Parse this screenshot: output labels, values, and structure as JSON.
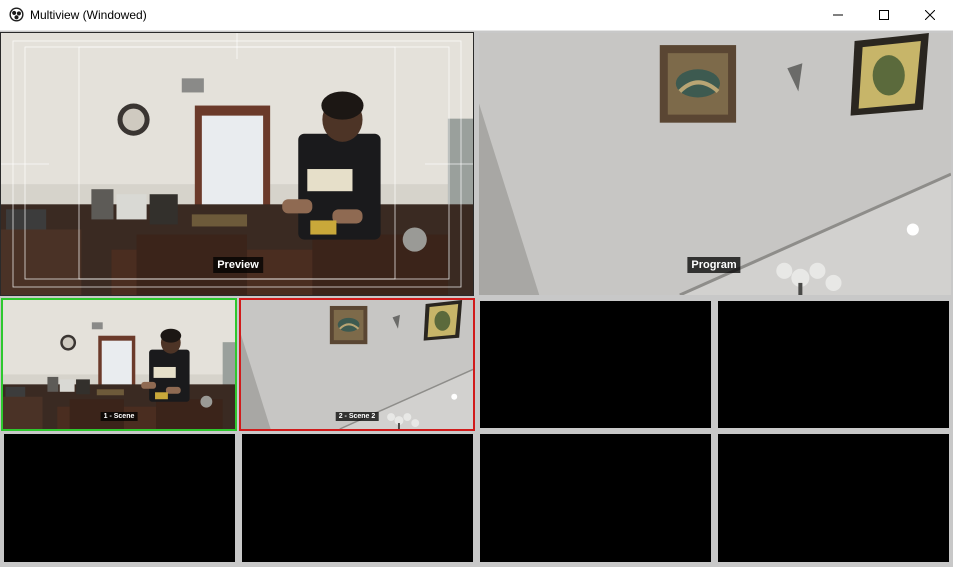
{
  "window": {
    "title": "Multiview (Windowed)"
  },
  "preview": {
    "label": "Preview"
  },
  "program": {
    "label": "Program"
  },
  "scenes": [
    {
      "label": "1 - Scene",
      "state": "preview",
      "border_color": "#2ec82e"
    },
    {
      "label": "2 - Scene 2",
      "state": "program",
      "border_color": "#d11b1b"
    },
    {
      "label": "",
      "state": "empty"
    },
    {
      "label": "",
      "state": "empty"
    },
    {
      "label": "",
      "state": "empty"
    },
    {
      "label": "",
      "state": "empty"
    },
    {
      "label": "",
      "state": "empty"
    },
    {
      "label": "",
      "state": "empty"
    }
  ],
  "colors": {
    "background": "#c8c8c8",
    "preview_border": "#2ec82e",
    "program_border": "#d11b1b"
  },
  "icons": {
    "app": "obs-logo-icon",
    "minimize": "minimize-icon",
    "maximize": "maximize-icon",
    "close": "close-icon"
  }
}
